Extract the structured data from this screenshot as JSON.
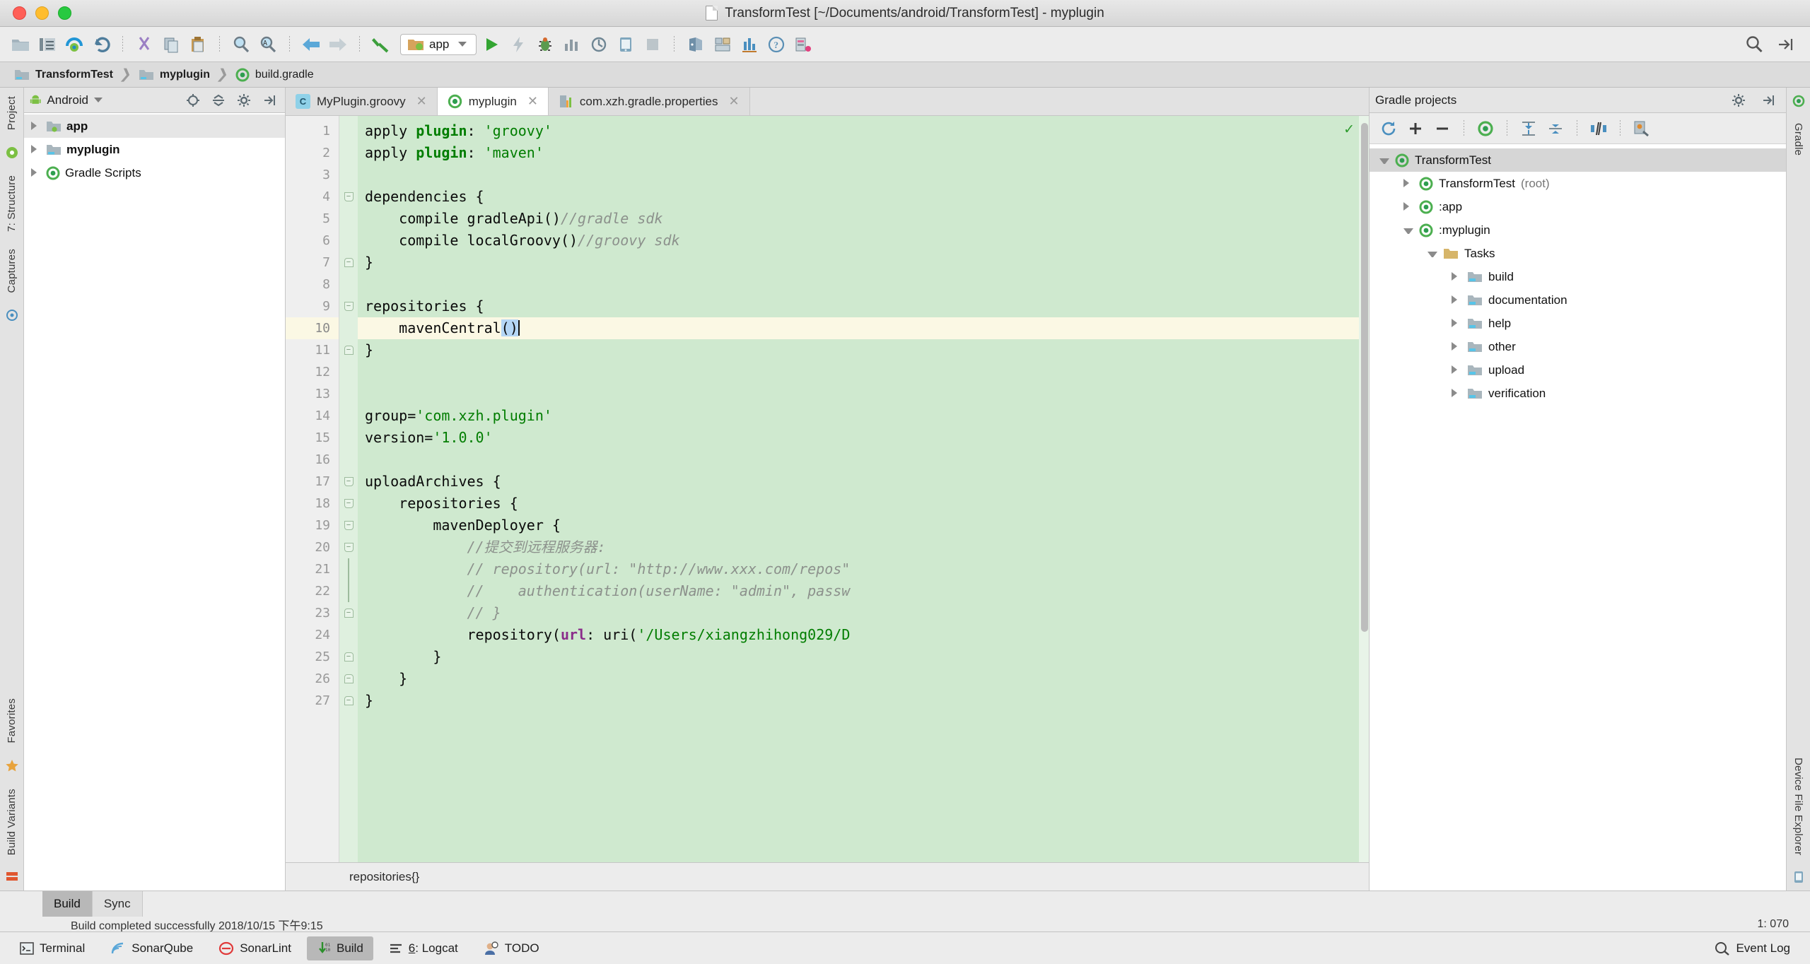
{
  "window": {
    "title": "TransformTest [~/Documents/android/TransformTest] - myplugin",
    "doc_icon": "document-icon",
    "buttons": {
      "close": "close-window",
      "minimize": "minimize-window",
      "zoom": "zoom-window"
    }
  },
  "toolbar": {
    "items": [
      {
        "name": "open-folder-icon",
        "label": "Open"
      },
      {
        "name": "save-all-icon",
        "label": "Save All"
      },
      {
        "name": "sync-project-icon",
        "label": "Sync Project with Gradle Files"
      },
      {
        "name": "undo-icon",
        "label": "Undo"
      },
      {
        "name": "cut-icon",
        "label": "Cut"
      },
      {
        "name": "copy-icon",
        "label": "Copy"
      },
      {
        "name": "paste-icon",
        "label": "Paste"
      },
      {
        "name": "find-icon",
        "label": "Find"
      },
      {
        "name": "replace-icon",
        "label": "Replace"
      },
      {
        "name": "back-icon",
        "label": "Back"
      },
      {
        "name": "forward-icon",
        "label": "Forward"
      },
      {
        "name": "build-hammer-icon",
        "label": "Make Project"
      }
    ],
    "run_config": {
      "label": "app",
      "icon": "android-module-icon"
    },
    "run_actions": [
      {
        "name": "run-icon",
        "label": "Run"
      },
      {
        "name": "apply-changes-icon",
        "label": "Apply Changes"
      },
      {
        "name": "debug-icon",
        "label": "Debug"
      },
      {
        "name": "profile-icon",
        "label": "Profile"
      },
      {
        "name": "attach-debugger-icon",
        "label": "Attach Debugger"
      },
      {
        "name": "avd-manager-icon",
        "label": "AVD Manager"
      },
      {
        "name": "stop-icon",
        "label": "Stop"
      },
      {
        "name": "sdk-manager-icon",
        "label": "SDK Manager"
      },
      {
        "name": "project-structure-icon",
        "label": "Project Structure"
      },
      {
        "name": "device-monitor-icon",
        "label": "Android Device Monitor"
      },
      {
        "name": "help-icon",
        "label": "Help"
      },
      {
        "name": "layout-inspector-icon",
        "label": "Layout Inspector"
      }
    ],
    "right_actions": [
      {
        "name": "search-everywhere-icon",
        "label": "Search Everywhere"
      },
      {
        "name": "toggle-panels-icon",
        "label": "Restore Layout"
      }
    ]
  },
  "breadcrumb": {
    "items": [
      {
        "label": "TransformTest",
        "icon": "folder-icon"
      },
      {
        "label": "myplugin",
        "icon": "folder-icon"
      },
      {
        "label": "build.gradle",
        "icon": "gradle-file-icon"
      }
    ],
    "separator": "›"
  },
  "left_rail": {
    "items": [
      {
        "label": "Project",
        "name": "tool-window-project"
      },
      {
        "label": "7: Structure",
        "name": "tool-window-structure"
      },
      {
        "label": "Captures",
        "name": "tool-window-captures"
      },
      {
        "label": "Favorites",
        "name": "tool-window-favorites"
      },
      {
        "label": "Build Variants",
        "name": "tool-window-build-variants"
      }
    ]
  },
  "right_rail": {
    "items": [
      {
        "label": "Gradle",
        "name": "tool-window-gradle"
      },
      {
        "label": "Device File Explorer",
        "name": "tool-window-device-file-explorer"
      }
    ]
  },
  "project_panel": {
    "view_selector": "Android",
    "view_icon": "android-head-icon",
    "actions": [
      {
        "name": "locate-icon",
        "label": "Select Opened File"
      },
      {
        "name": "collapse-all-icon",
        "label": "Collapse All"
      },
      {
        "name": "settings-gear-icon",
        "label": "Settings"
      },
      {
        "name": "hide-panel-icon",
        "label": "Hide"
      }
    ],
    "tree": [
      {
        "label": "app",
        "icon": "module-folder-icon",
        "expanded": false,
        "bold": true,
        "selected": true,
        "depth": 0
      },
      {
        "label": "myplugin",
        "icon": "module-folder-icon",
        "expanded": false,
        "bold": true,
        "selected": false,
        "depth": 0
      },
      {
        "label": "Gradle Scripts",
        "icon": "gradle-icon",
        "expanded": false,
        "bold": false,
        "selected": false,
        "depth": 0
      }
    ]
  },
  "editor": {
    "tabs": [
      {
        "label": "MyPlugin.groovy",
        "icon": "groovy-class-icon",
        "icon_text": "C",
        "active": false,
        "closable": true
      },
      {
        "label": "myplugin",
        "icon": "gradle-icon",
        "icon_text": "",
        "active": true,
        "closable": true
      },
      {
        "label": "com.xzh.gradle.properties",
        "icon": "properties-file-icon",
        "icon_text": "",
        "active": false,
        "closable": true
      }
    ],
    "status_line": "repositories{}",
    "inspection_status": "ok-check-icon",
    "current_line": 10,
    "lines": [
      {
        "n": 1,
        "fold": "",
        "html": "apply <span class=\"kw\">plugin</span>: <span class=\"str\">'groovy'</span>"
      },
      {
        "n": 2,
        "fold": "",
        "html": "apply <span class=\"kw\">plugin</span>: <span class=\"str\">'maven'</span>"
      },
      {
        "n": 3,
        "fold": "",
        "html": ""
      },
      {
        "n": 4,
        "fold": "down",
        "html": "dependencies {"
      },
      {
        "n": 5,
        "fold": "",
        "html": "    compile gradleApi()<span class=\"cmt\">//gradle sdk</span>"
      },
      {
        "n": 6,
        "fold": "",
        "html": "    compile localGroovy()<span class=\"cmt\">//groovy sdk</span>"
      },
      {
        "n": 7,
        "fold": "up",
        "html": "}"
      },
      {
        "n": 8,
        "fold": "",
        "html": ""
      },
      {
        "n": 9,
        "fold": "down",
        "html": "repositories {"
      },
      {
        "n": 10,
        "fold": "",
        "html": "    mavenCentral<span class=\"sel\">()</span><span class=\"caret\"></span>",
        "bulb": true,
        "current": true
      },
      {
        "n": 11,
        "fold": "up",
        "html": "}"
      },
      {
        "n": 12,
        "fold": "",
        "html": ""
      },
      {
        "n": 13,
        "fold": "",
        "html": ""
      },
      {
        "n": 14,
        "fold": "",
        "html": "group=<span class=\"str\">'com.xzh.plugin'</span>"
      },
      {
        "n": 15,
        "fold": "",
        "html": "version=<span class=\"str\">'1.0.0'</span>"
      },
      {
        "n": 16,
        "fold": "",
        "html": ""
      },
      {
        "n": 17,
        "fold": "down",
        "html": "uploadArchives {"
      },
      {
        "n": 18,
        "fold": "down2",
        "html": "    repositories {"
      },
      {
        "n": 19,
        "fold": "down3",
        "html": "        mavenDeployer {"
      },
      {
        "n": 20,
        "fold": "down4",
        "html": "            <span class=\"cmt\">//提交到远程服务器:</span>"
      },
      {
        "n": 21,
        "fold": "bar",
        "html": "            <span class=\"cmt\">// repository(url: \"http://www.xxx.com/repos\"</span>"
      },
      {
        "n": 22,
        "fold": "bar",
        "html": "            <span class=\"cmt\">//    authentication(userName: \"admin\", passw</span>"
      },
      {
        "n": 23,
        "fold": "up4",
        "html": "            <span class=\"cmt\">// }</span>"
      },
      {
        "n": 24,
        "fold": "",
        "html": "            repository(<span class=\"attr\">url</span>: uri(<span class=\"str\">'/Users/xiangzhihong029/D</span>"
      },
      {
        "n": 25,
        "fold": "up3",
        "html": "        }"
      },
      {
        "n": 26,
        "fold": "up2",
        "html": "    }"
      },
      {
        "n": 27,
        "fold": "up",
        "html": "}"
      }
    ]
  },
  "gradle_panel": {
    "title": "Gradle projects",
    "header_actions": [
      {
        "name": "settings-gear-icon",
        "label": "Settings"
      },
      {
        "name": "hide-panel-icon",
        "label": "Hide"
      }
    ],
    "toolbar": [
      {
        "name": "refresh-icon",
        "label": "Refresh all Gradle projects"
      },
      {
        "name": "add-icon",
        "label": "Link Gradle project"
      },
      {
        "name": "remove-icon",
        "label": "Detach external project"
      },
      {
        "name": "execute-task-icon",
        "label": "Execute Gradle Task"
      },
      {
        "name": "expand-all-icon",
        "label": "Expand All"
      },
      {
        "name": "collapse-all-icon",
        "label": "Collapse All"
      },
      {
        "name": "toggle-offline-icon",
        "label": "Toggle Offline Mode"
      },
      {
        "name": "gradle-settings-icon",
        "label": "Gradle Settings"
      }
    ],
    "tree": [
      {
        "label": "TransformTest",
        "suffix": "",
        "icon": "gradle-icon",
        "depth": 0,
        "state": "expanded",
        "selected": true
      },
      {
        "label": "TransformTest",
        "suffix": " (root)",
        "icon": "gradle-icon",
        "depth": 1,
        "state": "collapsed",
        "selected": false
      },
      {
        "label": ":app",
        "suffix": "",
        "icon": "gradle-icon",
        "depth": 1,
        "state": "collapsed",
        "selected": false
      },
      {
        "label": ":myplugin",
        "suffix": "",
        "icon": "gradle-icon",
        "depth": 1,
        "state": "expanded",
        "selected": false
      },
      {
        "label": "Tasks",
        "suffix": "",
        "icon": "folder-icon",
        "depth": 2,
        "state": "expanded",
        "selected": false
      },
      {
        "label": "build",
        "suffix": "",
        "icon": "task-folder-icon",
        "depth": 3,
        "state": "collapsed",
        "selected": false
      },
      {
        "label": "documentation",
        "suffix": "",
        "icon": "task-folder-icon",
        "depth": 3,
        "state": "collapsed",
        "selected": false
      },
      {
        "label": "help",
        "suffix": "",
        "icon": "task-folder-icon",
        "depth": 3,
        "state": "collapsed",
        "selected": false
      },
      {
        "label": "other",
        "suffix": "",
        "icon": "task-folder-icon",
        "depth": 3,
        "state": "collapsed",
        "selected": false
      },
      {
        "label": "upload",
        "suffix": "",
        "icon": "task-folder-icon",
        "depth": 3,
        "state": "collapsed",
        "selected": false
      },
      {
        "label": "verification",
        "suffix": "",
        "icon": "task-folder-icon",
        "depth": 3,
        "state": "collapsed",
        "selected": false
      }
    ]
  },
  "build_window": {
    "tabs": [
      {
        "label": "Build",
        "active": true
      },
      {
        "label": "Sync",
        "active": false
      }
    ],
    "message": "Build completed successfully 2018/10/15 下午9:15",
    "actions": [
      {
        "name": "settings-gear-icon",
        "label": "Settings"
      },
      {
        "name": "hide-panel-icon",
        "label": "Hide"
      }
    ],
    "right_text": "1: 070"
  },
  "statusbar": {
    "items": [
      {
        "label": "Terminal",
        "icon": "terminal-icon",
        "active": false
      },
      {
        "label": "SonarQube",
        "icon": "sonarqube-icon",
        "active": false
      },
      {
        "label": "SonarLint",
        "icon": "sonarlint-icon",
        "active": false
      },
      {
        "label": "Build",
        "icon": "build-binary-icon",
        "active": true
      },
      {
        "label": "6: Logcat",
        "icon": "logcat-icon",
        "active": false,
        "mnemonic": "6"
      },
      {
        "label": "TODO",
        "icon": "todo-icon",
        "active": false
      }
    ],
    "right": [
      {
        "label": "Event Log",
        "icon": "event-log-icon"
      }
    ]
  },
  "colors": {
    "code_bg": "#cfe9cf",
    "caret_row": "#fbf8e4",
    "keyword": "#017d00",
    "comment": "#8c918c",
    "selection": "#b5d6f5",
    "accent_green": "#3ddc84"
  }
}
